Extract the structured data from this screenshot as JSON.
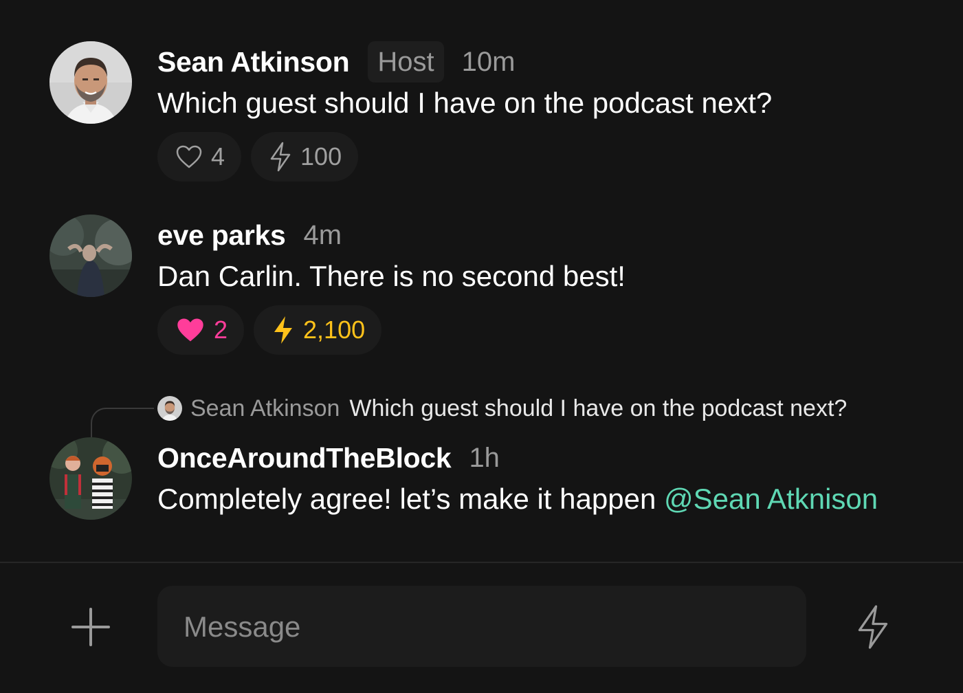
{
  "messages": [
    {
      "author": "Sean Atkinson",
      "badge": "Host",
      "time": "10m",
      "text": "Which guest should I have on the podcast next?",
      "likes": "4",
      "zaps": "100"
    },
    {
      "author": "eve parks",
      "time": "4m",
      "text": "Dan Carlin. There is no second best!",
      "likes": "2",
      "zaps": "2,100"
    },
    {
      "reply_to": {
        "author": "Sean Atkinson",
        "text": "Which guest should I have on the podcast next?"
      },
      "author": "OnceAroundTheBlock",
      "time": "1h",
      "text": "Completely agree! let’s make it happen ",
      "mention": "@Sean Atknison"
    }
  ],
  "composer": {
    "placeholder": "Message"
  },
  "colors": {
    "background": "#141414",
    "like_active": "#ff3d9a",
    "zap_active": "#ffc21a",
    "mention": "#5fd8b4"
  },
  "icons": [
    "heart-icon",
    "lightning-icon",
    "plus-icon"
  ]
}
